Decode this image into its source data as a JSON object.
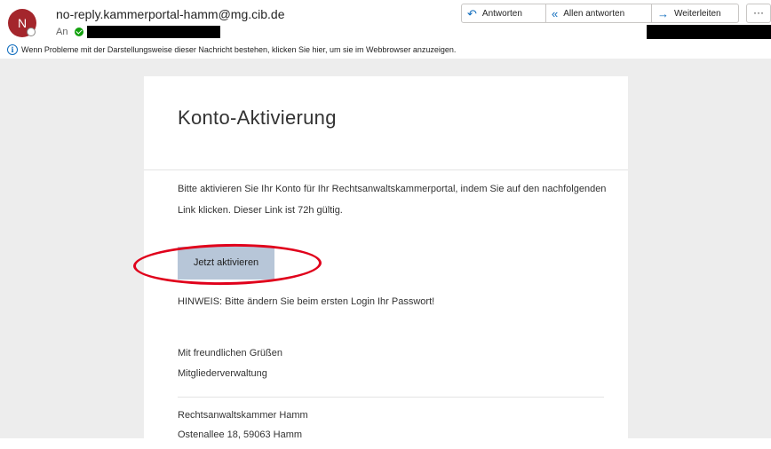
{
  "header": {
    "avatar_initial": "N",
    "sender": "no-reply.kammerportal-hamm@mg.cib.de",
    "to_label": "An",
    "actions": {
      "reply": "Antworten",
      "reply_all": "Allen antworten",
      "forward": "Weiterleiten",
      "more": "···"
    },
    "info_text": "Wenn Probleme mit der Darstellungsweise dieser Nachricht bestehen, klicken Sie hier, um sie im Webbrowser anzuzeigen.",
    "icons": {
      "reply": "reply-icon",
      "reply_all": "reply-all-icon",
      "forward": "forward-icon",
      "info": "info-icon",
      "verified": "check-icon"
    }
  },
  "email": {
    "title": "Konto-Aktivierung",
    "paragraph": "Bitte aktivieren Sie Ihr Konto für Ihr Rechtsanwaltskammerportal, indem Sie auf den nachfolgenden Link klicken. Dieser Link ist 72h gültig.",
    "button_label": "Jetzt aktivieren",
    "hint": "HINWEIS: Bitte ändern Sie beim ersten Login Ihr Passwort!",
    "greeting": "Mit freundlichen Grüßen",
    "department": "Mitgliederverwaltung",
    "org_name": "Rechtsanwaltskammer Hamm",
    "org_address": "Ostenallee 18, 59063 Hamm"
  },
  "colors": {
    "avatar": "#a4262c",
    "accent": "#0f6cbd",
    "button_bg": "#b7c6d8",
    "highlight": "#e0001b",
    "page_bg": "#ededed"
  }
}
